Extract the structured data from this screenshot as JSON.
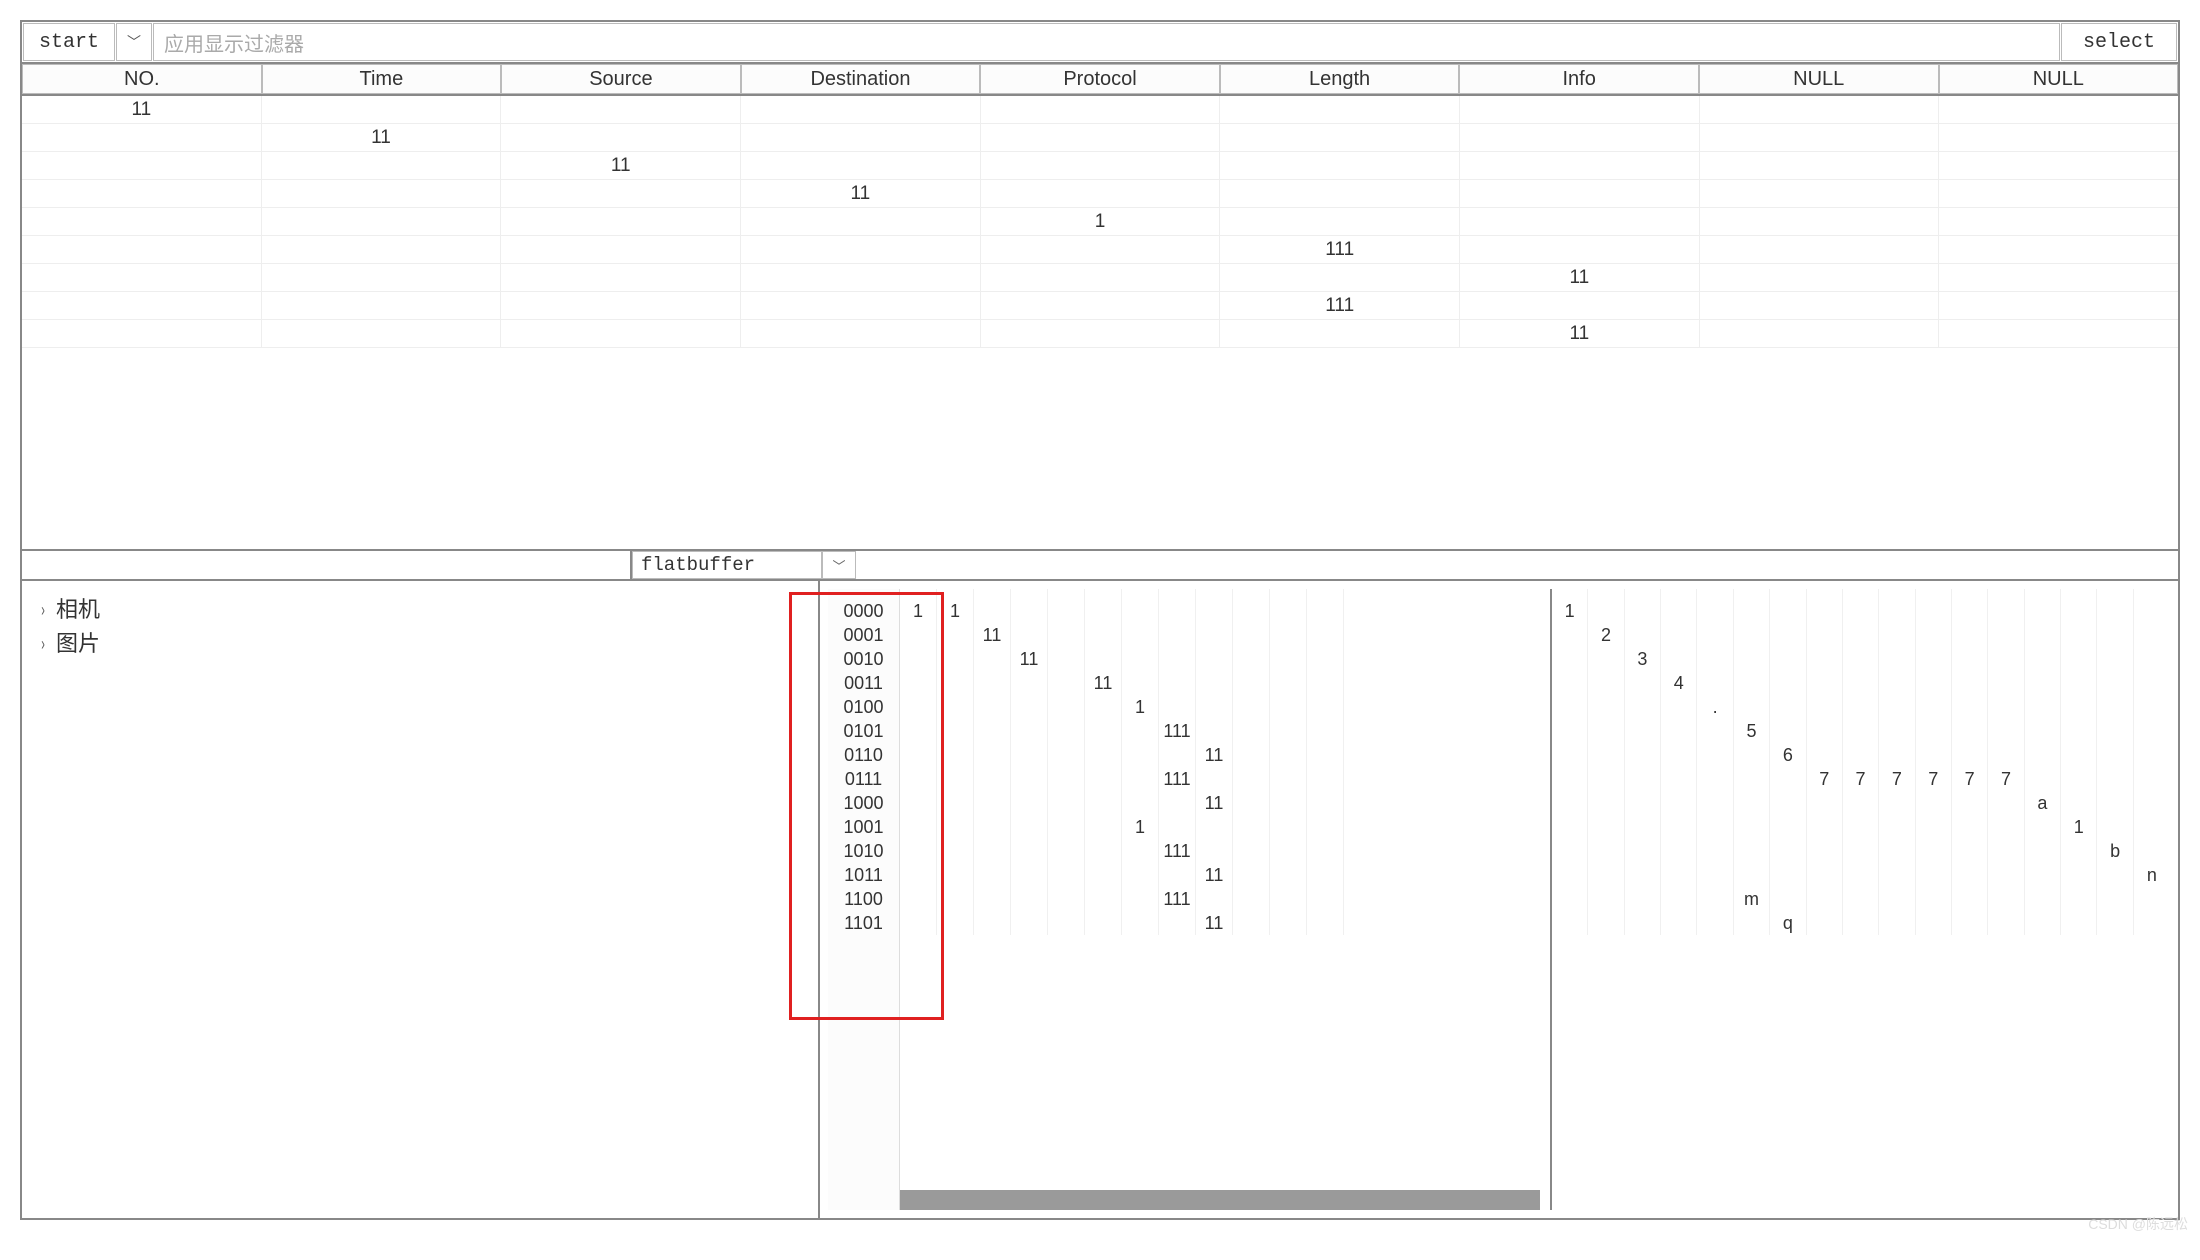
{
  "toolbar": {
    "start_label": "start",
    "filter_placeholder": "应用显示过滤器",
    "select_label": "select"
  },
  "columns": [
    "NO.",
    "Time",
    "Source",
    "Destination",
    "Protocol",
    "Length",
    "Info",
    "NULL",
    "NULL"
  ],
  "rows": [
    [
      "11",
      "",
      "",
      "",
      "",
      "",
      "",
      "",
      ""
    ],
    [
      "",
      "11",
      "",
      "",
      "",
      "",
      "",
      "",
      ""
    ],
    [
      "",
      "",
      "11",
      "",
      "",
      "",
      "",
      "",
      ""
    ],
    [
      "",
      "",
      "",
      "11",
      "",
      "",
      "",
      "",
      ""
    ],
    [
      "",
      "",
      "",
      "",
      "1",
      "",
      "",
      "",
      ""
    ],
    [
      "",
      "",
      "",
      "",
      "",
      "111",
      "",
      "",
      ""
    ],
    [
      "",
      "",
      "",
      "",
      "",
      "",
      "11",
      "",
      ""
    ],
    [
      "",
      "",
      "",
      "",
      "",
      "111",
      "",
      "",
      ""
    ],
    [
      "",
      "",
      "",
      "",
      "",
      "",
      "11",
      "",
      ""
    ]
  ],
  "mid": {
    "select_label": "flatbuffer"
  },
  "tree": {
    "items": [
      "相机",
      "图片"
    ]
  },
  "hex": {
    "offsets": [
      "0000",
      "0001",
      "0010",
      "0011",
      "0100",
      "0101",
      "0110",
      "0111",
      "1000",
      "1001",
      "1010",
      "1011",
      "1100",
      "1101"
    ],
    "cell_map": {
      "0": {
        "0": "1",
        "1": "1"
      },
      "1": {
        "2": "11"
      },
      "2": {
        "3": "11"
      },
      "3": {
        "5": "11"
      },
      "4": {
        "6": "1"
      },
      "5": {
        "7": "111"
      },
      "6": {
        "8": "11"
      },
      "7": {
        "7": "111"
      },
      "8": {
        "8": "11"
      },
      "9": {
        "6": "1"
      },
      "10": {
        "7": "111"
      },
      "11": {
        "8": "11"
      },
      "12": {
        "7": "111"
      },
      "13": {
        "8": "11"
      }
    }
  },
  "ascii": {
    "cell_map": {
      "0": {
        "0": "1"
      },
      "1": {
        "1": "2"
      },
      "2": {
        "2": "3"
      },
      "3": {
        "3": "4"
      },
      "4": {
        "4": "."
      },
      "5": {
        "5": "5"
      },
      "6": {
        "6": "6"
      },
      "7": {
        "7": "7",
        "8": "7",
        "9": "7",
        "10": "7",
        "11": "7",
        "12": "7"
      },
      "8": {
        "13": "a"
      },
      "9": {
        "14": "1"
      },
      "10": {
        "15": "b"
      },
      "11": {
        "16": "n"
      },
      "12": {
        "5": "m"
      },
      "13": {
        "6": "q"
      }
    }
  },
  "watermark": "CSDN @陈远松"
}
